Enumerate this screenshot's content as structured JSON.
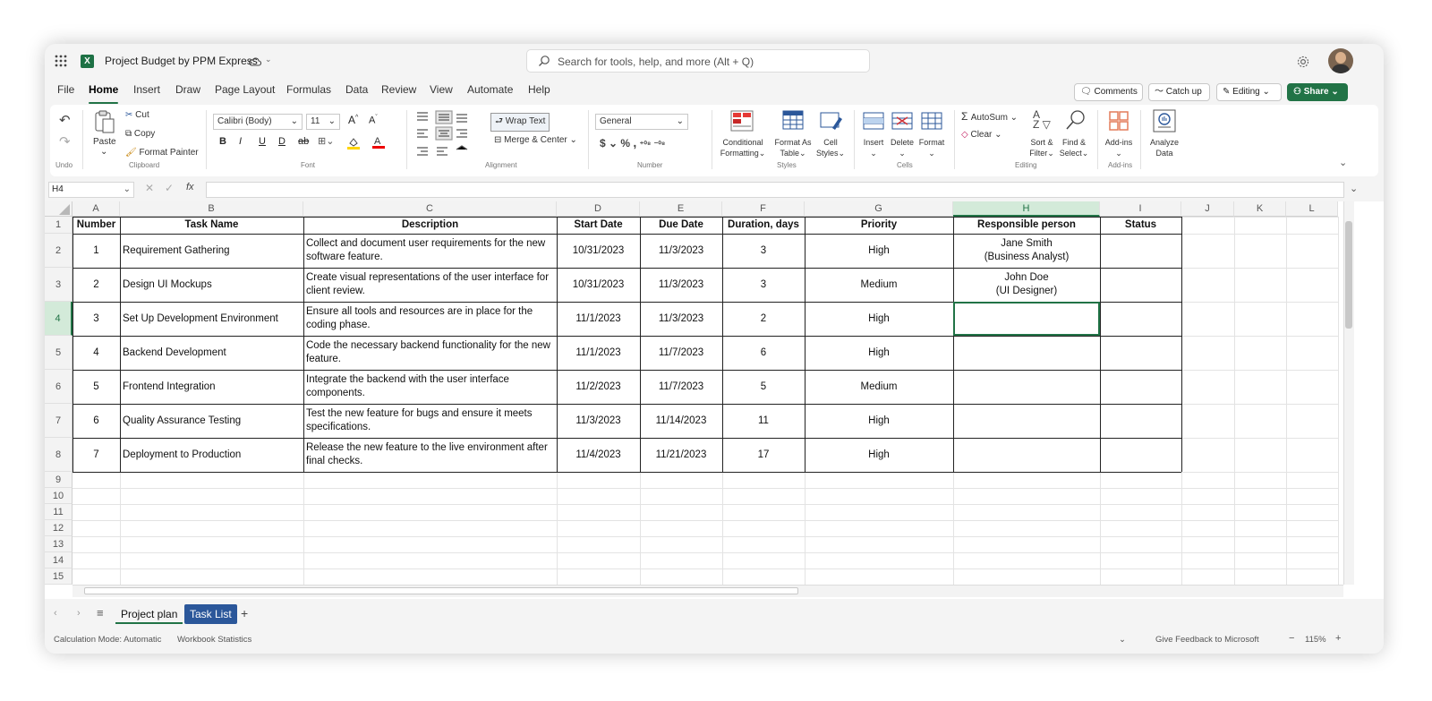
{
  "app": {
    "title": "Project Budget by PPM Express",
    "app_icon": "excel-icon"
  },
  "search": {
    "placeholder": "Search for tools, help, and more (Alt + Q)"
  },
  "menu": {
    "tabs": [
      "File",
      "Home",
      "Insert",
      "Draw",
      "Page Layout",
      "Formulas",
      "Data",
      "Review",
      "View",
      "Automate",
      "Help"
    ],
    "active": "Home"
  },
  "actions": {
    "comments": "Comments",
    "catch_up": "Catch up",
    "editing": "Editing",
    "share": "Share"
  },
  "ribbon": {
    "groups": {
      "undo": "Undo",
      "clipboard": "Clipboard",
      "font": "Font",
      "alignment": "Alignment",
      "number": "Number",
      "styles": "Styles",
      "cells": "Cells",
      "editing": "Editing",
      "addins": "Add-ins"
    },
    "paste": "Paste",
    "cut": "Cut",
    "copy": "Copy",
    "format_painter": "Format Painter",
    "font_name": "Calibri (Body)",
    "font_size": "11",
    "wrap_text": "Wrap Text",
    "merge_center": "Merge & Center",
    "number_format": "General",
    "conditional": "Conditional",
    "formatting": "Formatting",
    "format_as": "Format As",
    "table": "Table",
    "cell": "Cell",
    "styles": "Styles",
    "insert": "Insert",
    "delete": "Delete",
    "format": "Format",
    "autosum": "AutoSum",
    "clear": "Clear",
    "sort": "Sort &",
    "filter": "Filter",
    "find": "Find &",
    "select": "Select",
    "addins": "Add-ins",
    "analyze": "Analyze",
    "data": "Data"
  },
  "formula_bar": {
    "name_box": "H4",
    "formula": ""
  },
  "columns": [
    "A",
    "B",
    "C",
    "D",
    "E",
    "F",
    "G",
    "H",
    "I",
    "J",
    "K",
    "L"
  ],
  "selected_cell": "H4",
  "rows": [
    "1",
    "2",
    "3",
    "4",
    "5",
    "6",
    "7",
    "8",
    "9",
    "10",
    "11",
    "12",
    "13",
    "14",
    "15"
  ],
  "table": {
    "headers": [
      "Number",
      "Task Name",
      "Description",
      "Start Date",
      "Due Date",
      "Duration, days",
      "Priority",
      "Responsible person",
      "Status"
    ],
    "data": [
      [
        "1",
        "Requirement Gathering",
        "Collect and document user requirements for the new software feature.",
        "10/31/2023",
        "11/3/2023",
        "3",
        "High",
        "Jane Smith\n(Business Analyst)",
        ""
      ],
      [
        "2",
        "Design UI Mockups",
        "Create visual representations of the user interface for client review.",
        "10/31/2023",
        "11/3/2023",
        "3",
        "Medium",
        "John Doe\n(UI Designer)",
        ""
      ],
      [
        "3",
        "Set Up Development Environment",
        "Ensure all tools and resources are in place for the coding phase.",
        "11/1/2023",
        "11/3/2023",
        "2",
        "High",
        "",
        ""
      ],
      [
        "4",
        "Backend Development",
        "Code the necessary backend functionality for the new feature.",
        "11/1/2023",
        "11/7/2023",
        "6",
        "High",
        "",
        ""
      ],
      [
        "5",
        "Frontend Integration",
        "Integrate the backend with the user interface components.",
        "11/2/2023",
        "11/7/2023",
        "5",
        "Medium",
        "",
        ""
      ],
      [
        "6",
        "Quality Assurance Testing",
        "Test the new feature for bugs and ensure it meets specifications.",
        "11/3/2023",
        "11/14/2023",
        "11",
        "High",
        "",
        ""
      ],
      [
        "7",
        "Deployment to Production",
        "Release the new feature to the live environment after final checks.",
        "11/4/2023",
        "11/21/2023",
        "17",
        "High",
        "",
        ""
      ]
    ]
  },
  "sheets": [
    {
      "name": "Project plan",
      "active": true
    },
    {
      "name": "Task List",
      "active": false
    }
  ],
  "status": {
    "calc_mode": "Calculation Mode: Automatic",
    "workbook_stats": "Workbook Statistics",
    "feedback": "Give Feedback to Microsoft",
    "zoom": "115%"
  },
  "colors": {
    "accent": "#217346",
    "share_button": "#217346",
    "task_list_tab": "#2b579a"
  }
}
